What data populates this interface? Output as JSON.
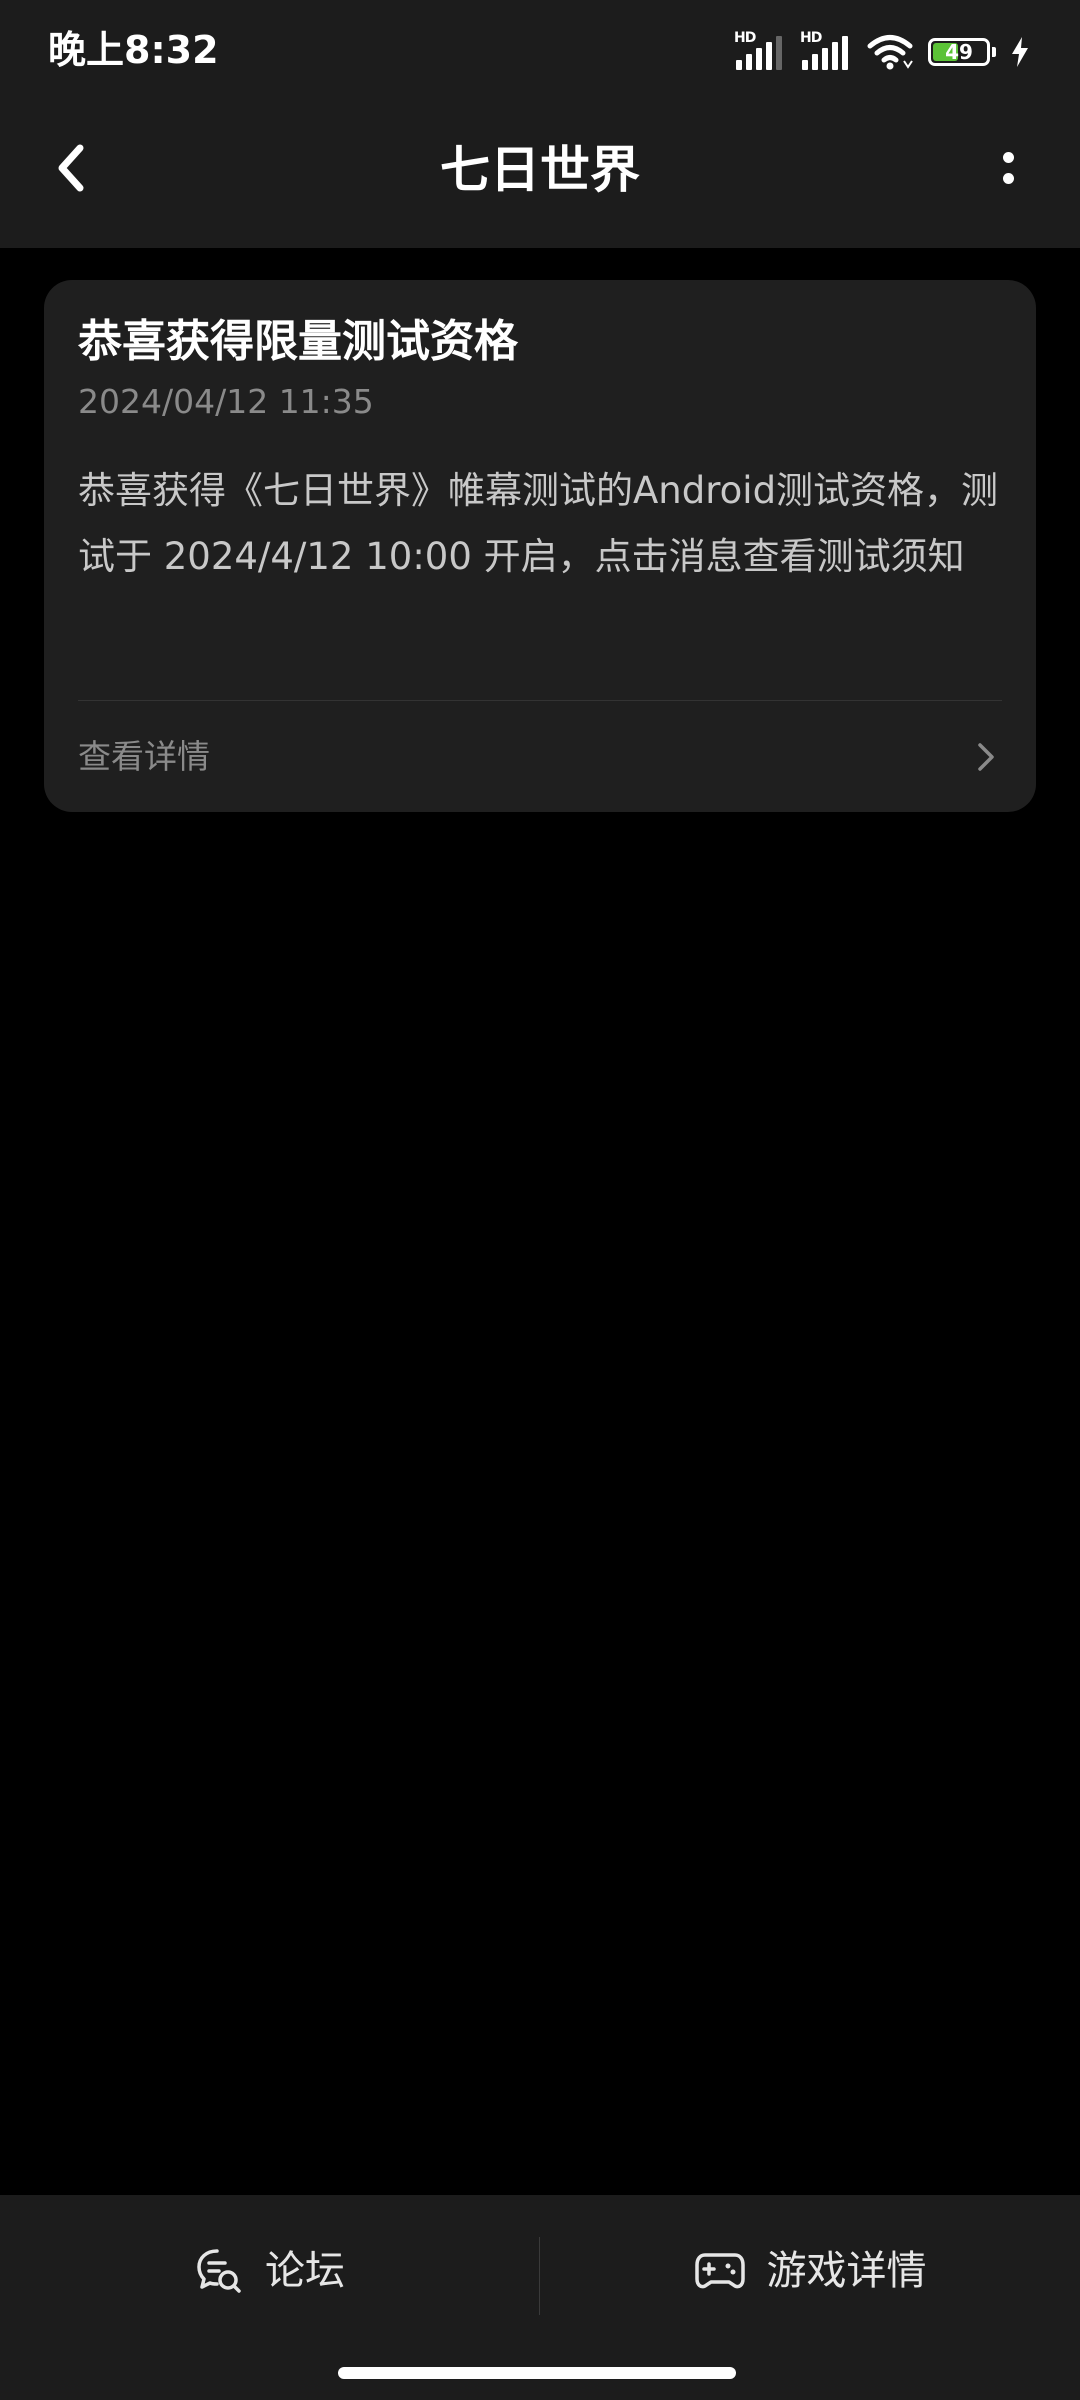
{
  "status_bar": {
    "time": "晚上8:32",
    "signal1_label": "HD",
    "signal2_label": "HD",
    "battery_level": "49",
    "battery_fraction": 0.49,
    "battery_color": "#5bc236",
    "icons": [
      "signal-hd-icon",
      "signal-hd-icon",
      "wifi-icon",
      "battery-icon",
      "charging-icon"
    ]
  },
  "app_bar": {
    "title": "七日世界",
    "back_icon": "back-arrow-icon",
    "more_icon": "more-vertical-icon"
  },
  "message_card": {
    "title": "恭喜获得限量测试资格",
    "timestamp": "2024/04/12 11:35",
    "body": "恭喜获得《七日世界》帷幕测试的Android测试资格，测试于 2024/4/12 10:00 开启，点击消息查看测试须知",
    "link_label": "查看详情",
    "link_icon": "chevron-right-icon"
  },
  "bottom_bar": {
    "tabs": [
      {
        "label": "论坛",
        "icon": "forum-chat-icon"
      },
      {
        "label": "游戏详情",
        "icon": "gamepad-icon"
      }
    ]
  },
  "colors": {
    "background": "#000000",
    "surface": "#1c1c1c",
    "card": "#1f1f1f",
    "primary_text": "#ffffff",
    "secondary_text": "#8a8a8a"
  }
}
